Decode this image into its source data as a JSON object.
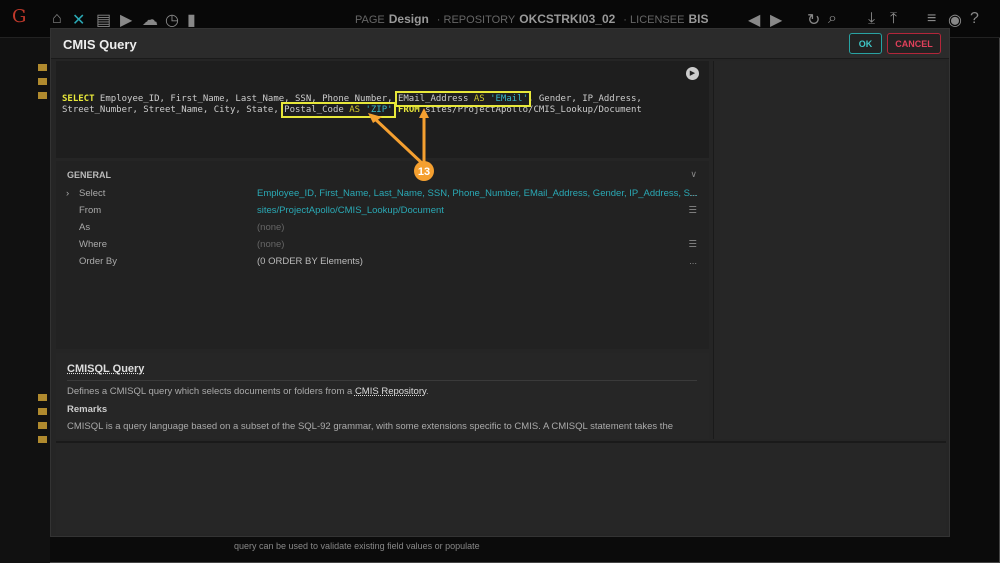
{
  "topbar": {
    "page_label": "PAGE",
    "page": "Design",
    "repo_label": "REPOSITORY",
    "repo": "OKCSTRKI03_02",
    "licensee_label": "LICENSEE",
    "licensee": "BIS"
  },
  "dialog": {
    "title": "CMIS Query",
    "ok": "OK",
    "cancel": "CANCEL"
  },
  "sql": {
    "select": "SELECT",
    "line1a": " Employee_ID, First_Name, Last_Name, SSN, Phone_Number, ",
    "email": "EMail_Address",
    "as": "AS",
    "email_alias": "'EMail'",
    "line1b": ", Gender, IP_Address,",
    "line2a": "Street_Number, Street_Name, City, State, ",
    "postal": "Postal_Code",
    "zip_alias": "'ZIP'",
    "from": "FROM",
    "path": "sites/ProjectApollo/CMIS_Lookup/Document"
  },
  "callout": "13",
  "general": {
    "header": "GENERAL",
    "rows": [
      {
        "label": "Select",
        "value": "Employee_ID, First_Name, Last_Name, SSN, Phone_Number, EMail_Address, Gender, IP_Address, S...",
        "action": "..."
      },
      {
        "label": "From",
        "value": "sites/ProjectApollo/CMIS_Lookup/Document",
        "action": "☰"
      },
      {
        "label": "As",
        "value": "(none)",
        "action": ""
      },
      {
        "label": "Where",
        "value": "(none)",
        "action": "☰"
      },
      {
        "label": "Order By",
        "value": "(0 ORDER BY Elements)",
        "action": "..."
      }
    ]
  },
  "help": {
    "title": "CMISQL Query",
    "desc": "Defines a CMISQL query which selects documents or folders from a ",
    "link": "CMIS Repository",
    "period": ".",
    "remarks": "Remarks",
    "remarks_text": "CMISQL is a query language based on a subset of the SQL-92 grammar, with some extensions specific to CMIS. A CMISQL statement takes the"
  },
  "background_text": "query can be used to validate existing field values or populate"
}
